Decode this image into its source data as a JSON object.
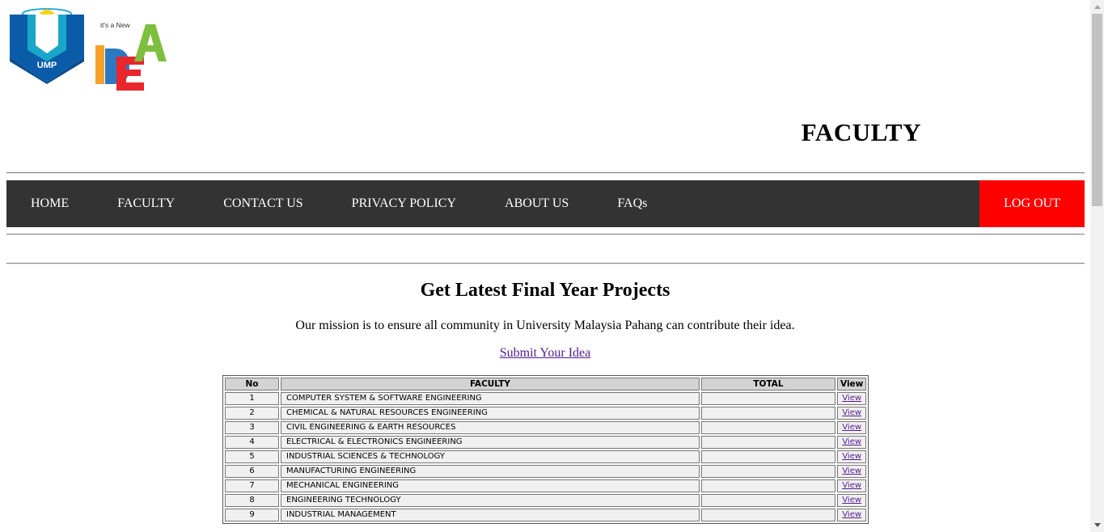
{
  "logos": {
    "ump_text": "UMP",
    "idea_small": "it's a New",
    "idea_letters": [
      "I",
      "D",
      "E",
      "A"
    ]
  },
  "header": {
    "title": "FACULTY"
  },
  "nav": {
    "items": [
      "HOME",
      "FACULTY",
      "CONTACT US",
      "PRIVACY POLICY",
      "ABOUT US",
      "FAQs"
    ],
    "logout": "LOG OUT"
  },
  "main": {
    "heading": "Get Latest Final Year Projects",
    "mission": "Our mission is to ensure all community in University Malaysia Pahang can contribute their idea.",
    "submit_link": "Submit Your Idea"
  },
  "table": {
    "headers": [
      "No",
      "FACULTY",
      "TOTAL",
      "View"
    ],
    "rows": [
      {
        "no": "1",
        "faculty": "COMPUTER SYSTEM & SOFTWARE ENGINEERING",
        "total": "",
        "view": "View"
      },
      {
        "no": "2",
        "faculty": "CHEMICAL & NATURAL RESOURCES ENGINEERING",
        "total": "",
        "view": "View"
      },
      {
        "no": "3",
        "faculty": "CIVIL ENGINEERING & EARTH RESOURCES",
        "total": "",
        "view": "View"
      },
      {
        "no": "4",
        "faculty": "ELECTRICAL & ELECTRONICS ENGINEERING",
        "total": "",
        "view": "View"
      },
      {
        "no": "5",
        "faculty": "INDUSTRIAL SCIENCES & TECHNOLOGY",
        "total": "",
        "view": "View"
      },
      {
        "no": "6",
        "faculty": "MANUFACTURING ENGINEERING",
        "total": "",
        "view": "View"
      },
      {
        "no": "7",
        "faculty": "MECHANICAL ENGINEERING",
        "total": "",
        "view": "View"
      },
      {
        "no": "8",
        "faculty": "ENGINEERING TECHNOLOGY",
        "total": "",
        "view": "View"
      },
      {
        "no": "9",
        "faculty": "INDUSTRIAL MANAGEMENT",
        "total": "",
        "view": "View"
      }
    ]
  },
  "colors": {
    "nav_bg": "#333333",
    "logout_bg": "#ff0000",
    "link": "#551a8b"
  }
}
